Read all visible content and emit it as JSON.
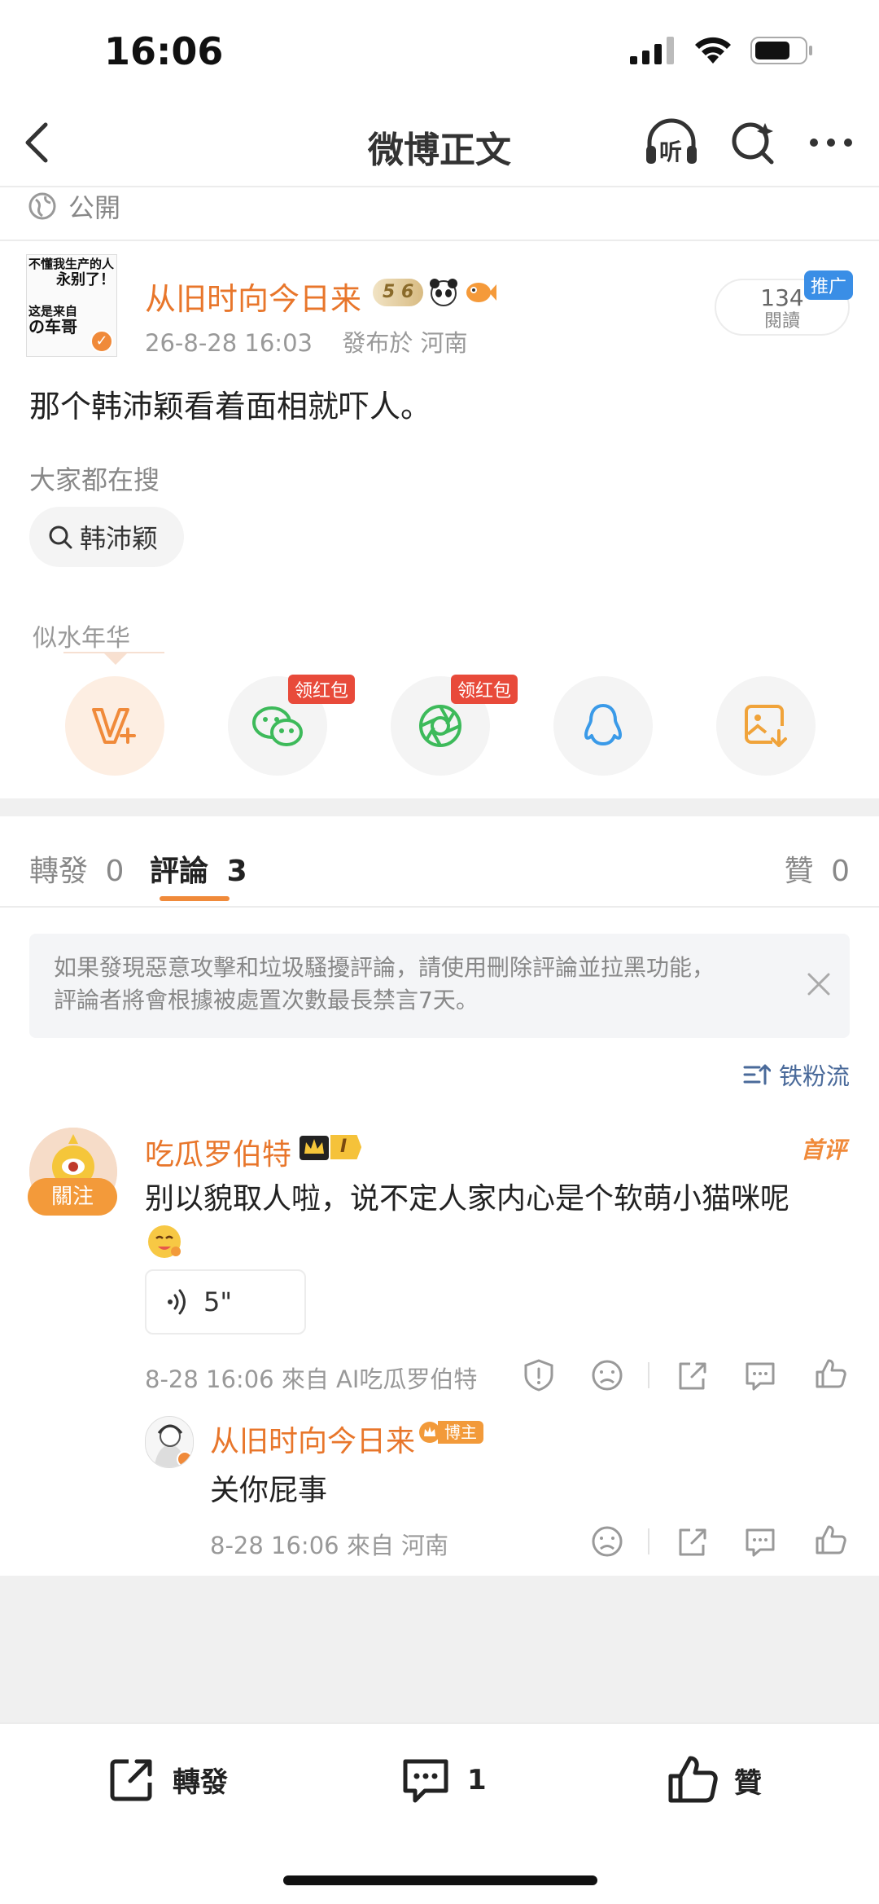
{
  "status_bar": {
    "time": "16:06"
  },
  "nav": {
    "title": "微博正文",
    "listen_label": "听"
  },
  "visibility": {
    "label": "公開"
  },
  "post": {
    "author": "从旧时向今日来",
    "avatar_text": [
      "不懂我生产的人",
      "永别了！",
      "这是来自",
      "の车哥"
    ],
    "badge_level": "5 6",
    "time": "26-8-28 16:03",
    "location": "發布於 河南",
    "reads": "134",
    "reads_label": "閱讀",
    "promo_label": "推广",
    "content": "那个韩沛颖看着面相就吓人。"
  },
  "search": {
    "heading": "大家都在搜",
    "chip": "韩沛颖"
  },
  "bgm": {
    "label": "似水年华"
  },
  "share": {
    "items": [
      {
        "name": "vip",
        "icon": "vplus-icon"
      },
      {
        "name": "wechat",
        "icon": "wechat-icon",
        "tag": "领红包"
      },
      {
        "name": "moments",
        "icon": "moments-icon",
        "tag": "领红包"
      },
      {
        "name": "qq",
        "icon": "qq-icon"
      },
      {
        "name": "save-image",
        "icon": "save-image-icon"
      }
    ]
  },
  "tabs": {
    "repost": "轉發",
    "repost_count": "0",
    "comment": "評論",
    "comment_count": "3",
    "like": "贊",
    "like_count": "0"
  },
  "notice": {
    "line1": "如果發現惡意攻擊和垃圾騷擾評論，請使用刪除評論並拉黑功能，",
    "line2": "評論者將會根據被處置次數最長禁言7天。"
  },
  "sort": {
    "label": "铁粉流"
  },
  "comment": {
    "author": "吃瓜罗伯特",
    "follow_label": "關注",
    "level_badge": "I",
    "first_label": "首评",
    "text": "别以貌取人啦，说不定人家内心是个软萌小猫咪呢",
    "voice_duration": "5\"",
    "meta": "8-28 16:06  來自 AI吃瓜罗伯特"
  },
  "reply": {
    "author": "从旧时向今日来",
    "badge": "博主",
    "text": "关你屁事",
    "meta": "8-28 16:06  來自 河南"
  },
  "bottom_bar": {
    "repost": "轉發",
    "comment_count": "1",
    "like": "贊"
  },
  "colors": {
    "accent_orange": "#e8762b",
    "tab_indicator": "#f08a3a",
    "link_blue": "#4a6a9a",
    "promo_blue": "#3a8ee6",
    "redpack_red": "#e84a3a"
  }
}
